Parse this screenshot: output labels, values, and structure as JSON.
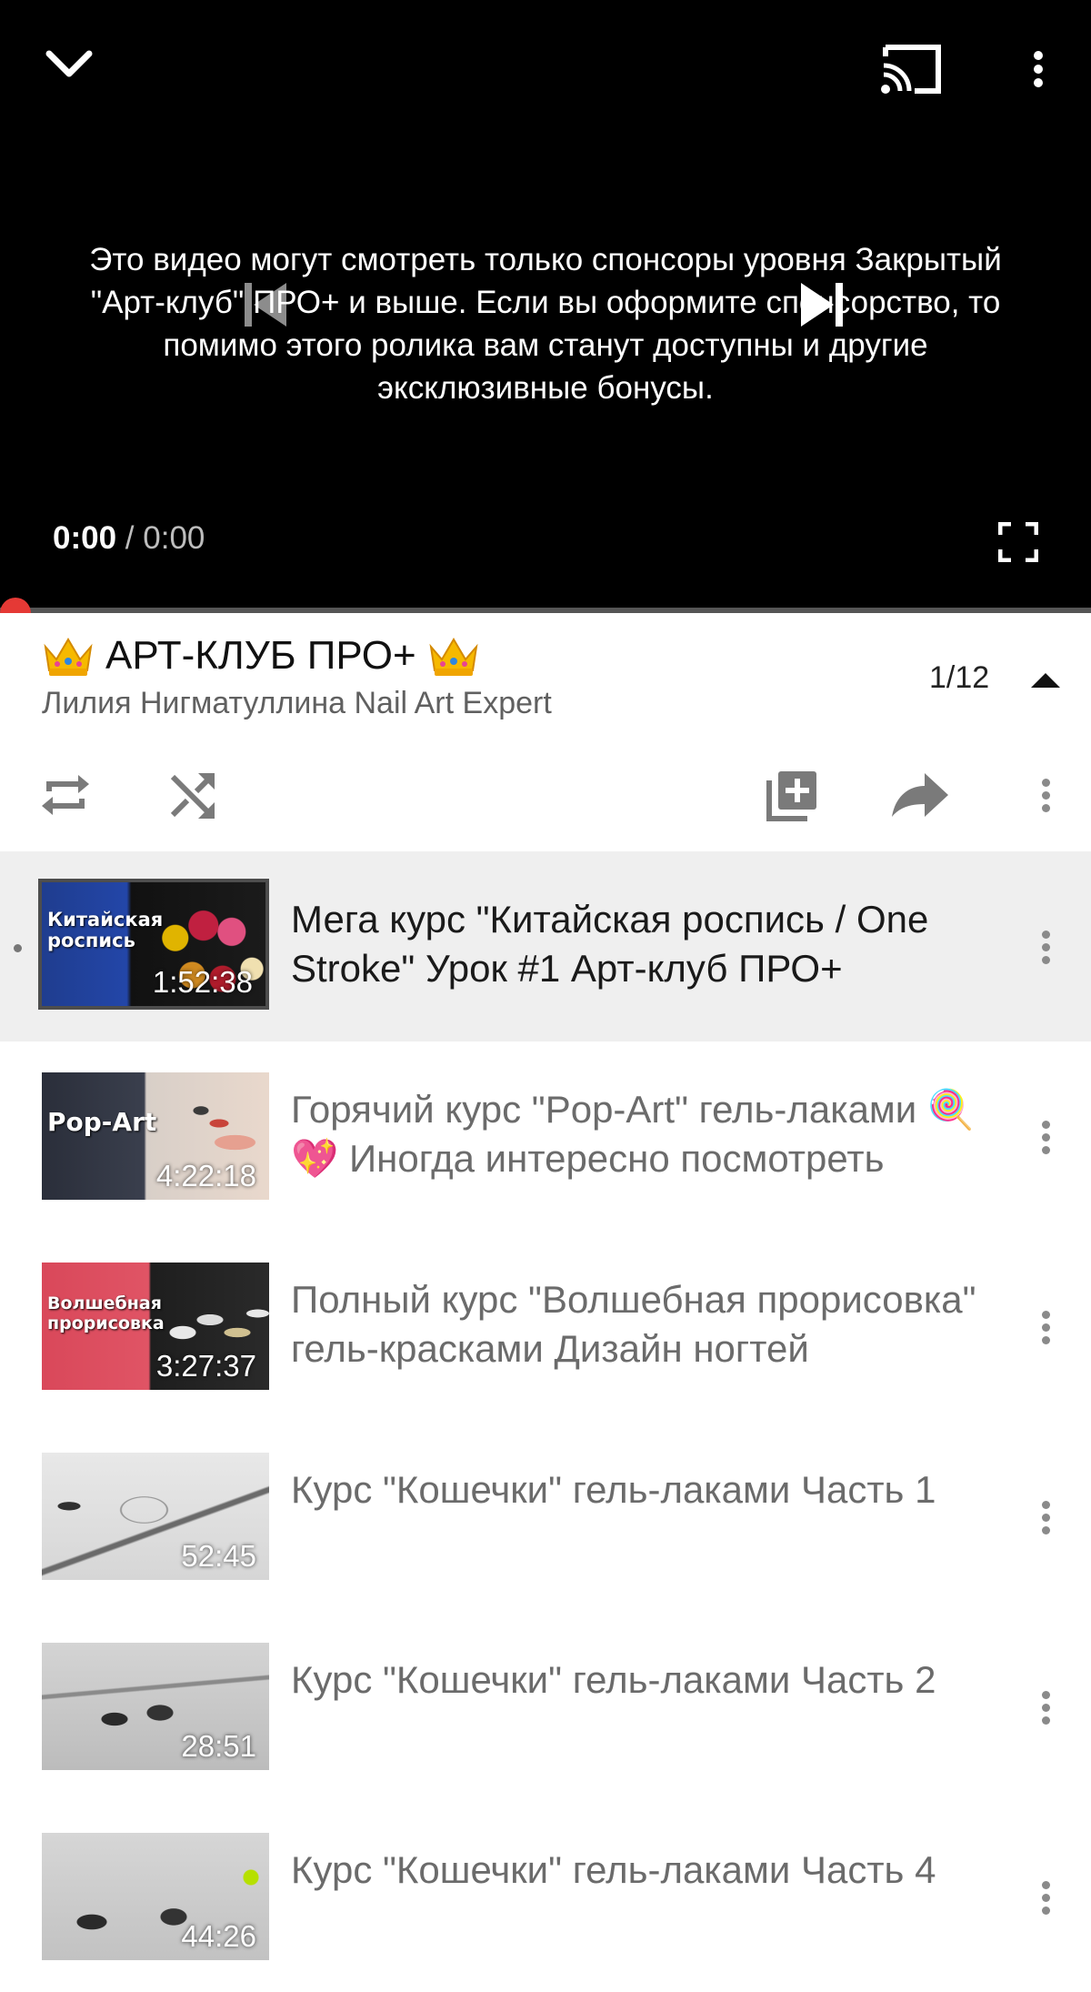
{
  "player": {
    "sponsor_message": "Это видео могут смотреть только спонсоры уровня Закрытый \"Арт-клуб\" ПРО+ и выше. Если вы оформите спонсорство, то помимо этого ролика вам станут доступны и другие эксклюзивные бонусы.",
    "current_time": "0:00",
    "separator": "/",
    "duration": "0:00",
    "progress_fraction": 0
  },
  "playlist": {
    "title": "АРТ-КЛУБ ПРО+",
    "owner": "Лилия Нигматуллина Nail Art Expert",
    "position": "1/12"
  },
  "items": [
    {
      "title": "Мега курс \"Китайская роспись / One Stroke\" Урок #1 Арт-клуб ПРО+",
      "duration": "1:52:38",
      "thumb_text": "Китайская роспись",
      "active": true
    },
    {
      "title": "Горячий курс \"Pop-Art\" гель-лаками 🍭💖 Иногда интересно посмотреть",
      "duration": "4:22:18",
      "thumb_text": "Pop-Art"
    },
    {
      "title": "Полный курс \"Волшебная прорисовка\" гель-красками Дизайн ногтей",
      "duration": "3:27:37",
      "thumb_text": "Волшебная прорисовка"
    },
    {
      "title": "Курс \"Кошечки\" гель-лаками Часть 1",
      "duration": "52:45",
      "thumb_text": ""
    },
    {
      "title": "Курс \"Кошечки\" гель-лаками Часть 2",
      "duration": "28:51",
      "thumb_text": ""
    },
    {
      "title": "Курс \"Кошечки\" гель-лаками Часть 4",
      "duration": "44:26",
      "thumb_text": ""
    }
  ],
  "icons": {
    "collapse": "chevron-down-icon",
    "cast": "cast-icon",
    "more": "more-vert-icon",
    "prev": "skip-previous-icon",
    "next": "skip-next-icon",
    "fullscreen": "fullscreen-icon",
    "repeat": "repeat-icon",
    "shuffle": "shuffle-icon",
    "save": "add-to-playlist-icon",
    "share": "share-icon",
    "caret": "caret-up-icon"
  },
  "colors": {
    "accent": "#e53935",
    "player_bg": "#000000",
    "active_row": "#efefef"
  }
}
